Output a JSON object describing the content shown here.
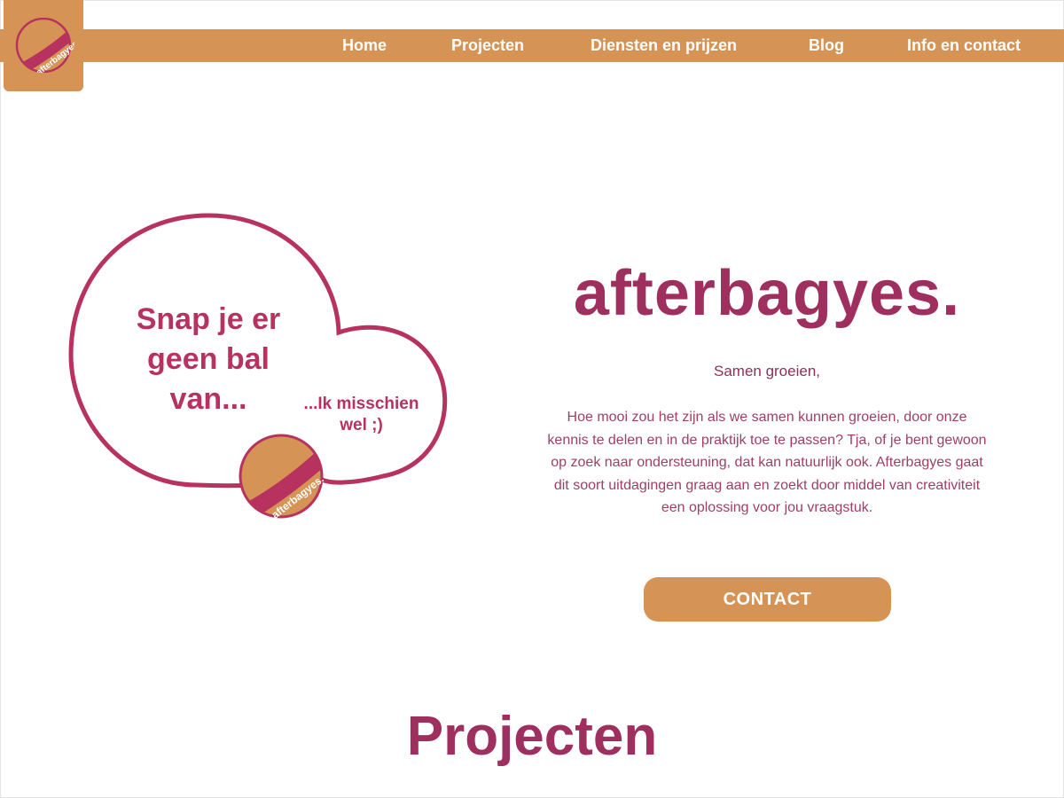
{
  "header": {
    "logo_text": "afterbagyes.",
    "nav": {
      "home": "Home",
      "projects": "Projecten",
      "services": "Diensten en prijzen",
      "blog": "Blog",
      "info": "Info en contact"
    }
  },
  "hero": {
    "bubble_main": "Snap je er geen bal van...",
    "bubble_small": "...Ik misschien wel ;)",
    "ball_text": "afterbagyes.",
    "title": "afterbagyes.",
    "tagline": "Samen groeien,",
    "intro": "Hoe mooi zou het zijn als we samen kunnen groeien, door onze kennis te delen en in de praktijk toe te passen? Tja, of je bent gewoon op zoek naar ondersteuning, dat kan natuurlijk ook. Afterbagyes gaat dit soort uitdagingen graag aan en zoekt door middel van creativiteit een oplossing voor jou vraagstuk.",
    "cta": "CONTACT"
  },
  "projects": {
    "title": "Projecten"
  },
  "colors": {
    "accent_orange": "#d59355",
    "brand_magenta": "#9e2f5e",
    "bubble_magenta": "#b8325f"
  }
}
